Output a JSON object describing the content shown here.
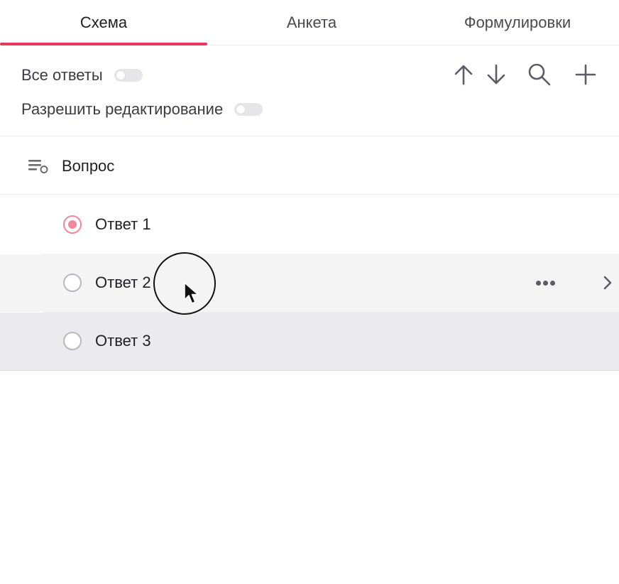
{
  "tabs": [
    {
      "label": "Схема",
      "active": true
    },
    {
      "label": "Анкета",
      "active": false
    },
    {
      "label": "Формулировки",
      "active": false
    }
  ],
  "accent_color": "#e9365d",
  "settings": {
    "all_answers_label": "Все ответы",
    "all_answers_on": false,
    "allow_edit_label": "Разрешить редактирование",
    "allow_edit_on": false
  },
  "toolbar": {
    "icons": [
      "arrow-up-icon",
      "arrow-down-icon",
      "search-icon",
      "plus-icon"
    ]
  },
  "question": {
    "label": "Вопрос",
    "icon": "question-list-icon"
  },
  "answers": [
    {
      "label": "Ответ 1",
      "selected": true
    },
    {
      "label": "Ответ 2",
      "selected": false,
      "hovered": true
    },
    {
      "label": "Ответ 3",
      "selected": false
    }
  ],
  "row_actions": {
    "icons": [
      "more-dots-icon",
      "chevron-right-icon"
    ]
  }
}
